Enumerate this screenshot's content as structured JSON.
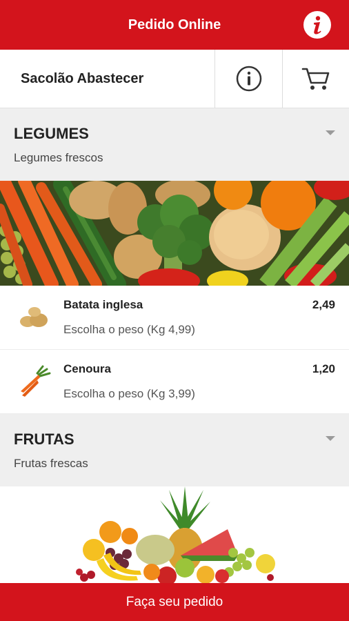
{
  "header": {
    "title": "Pedido Online",
    "info_icon": "info-icon"
  },
  "store": {
    "name": "Sacolão Abastecer",
    "info_icon": "info-outline-icon",
    "cart_icon": "cart-icon"
  },
  "sections": [
    {
      "title": "LEGUMES",
      "subtitle": "Legumes frescos",
      "products": [
        {
          "name": "Batata inglesa",
          "description": "Escolha o peso (Kg 4,99)",
          "price": "2,49",
          "icon": "potato-icon"
        },
        {
          "name": "Cenoura",
          "description": "Escolha o peso (Kg 3,99)",
          "price": "1,20",
          "icon": "carrot-icon"
        }
      ]
    },
    {
      "title": "FRUTAS",
      "subtitle": "Frutas frescas",
      "products": []
    }
  ],
  "footer": {
    "label": "Faça seu pedido"
  },
  "colors": {
    "brand_red": "#d3141c",
    "section_bg": "#efefef"
  }
}
